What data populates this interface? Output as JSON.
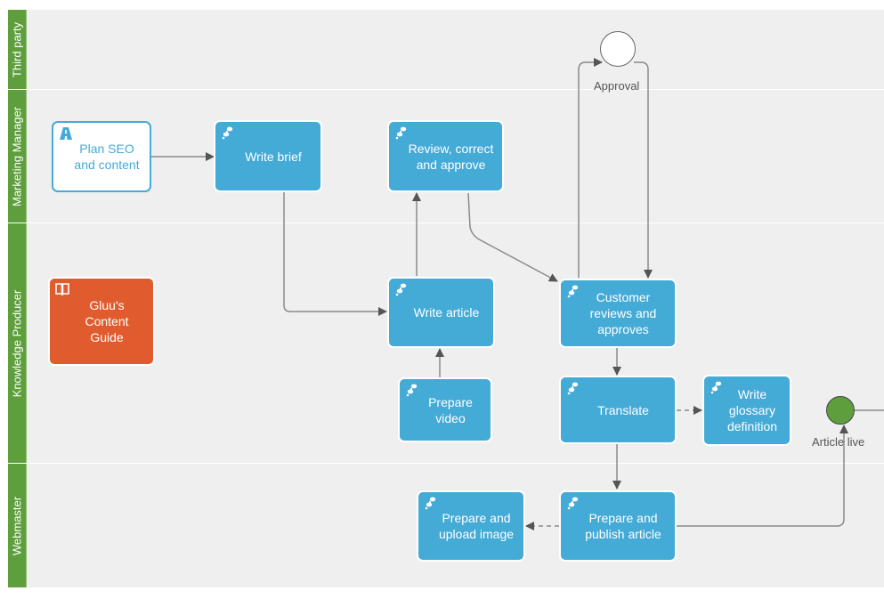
{
  "lanes": [
    {
      "label": "Third party"
    },
    {
      "label": "Marketing Manager"
    },
    {
      "label": "Knowledge Producer"
    },
    {
      "label": "Webmaster"
    }
  ],
  "nodes": {
    "plan_seo": {
      "label": "Plan SEO and content",
      "icon": "road-icon"
    },
    "write_brief": {
      "label": "Write brief",
      "icon": "footsteps-icon"
    },
    "review": {
      "label": "Review, correct and approve",
      "icon": "footsteps-icon"
    },
    "guide": {
      "label": "Gluu's Content Guide",
      "icon": "book-icon"
    },
    "write_article": {
      "label": "Write article",
      "icon": "footsteps-icon"
    },
    "prepare_video": {
      "label": "Prepare video",
      "icon": "footsteps-icon"
    },
    "customer_reviews": {
      "label": "Customer reviews and approves",
      "icon": "footsteps-icon"
    },
    "translate": {
      "label": "Translate",
      "icon": "footsteps-icon"
    },
    "glossary": {
      "label": "Write glossary definition",
      "icon": "footsteps-icon"
    },
    "prepare_upload": {
      "label": "Prepare and upload image",
      "icon": "footsteps-icon"
    },
    "publish": {
      "label": "Prepare and publish article",
      "icon": "footsteps-icon"
    }
  },
  "events": {
    "approval": {
      "label": "Approval"
    },
    "article_live": {
      "label": "Article live"
    }
  },
  "colors": {
    "lane_header": "#5e9e3d",
    "task": "#44aad6",
    "guide": "#e05c2e",
    "end_event": "#5e9e3d",
    "connector": "#777777"
  }
}
